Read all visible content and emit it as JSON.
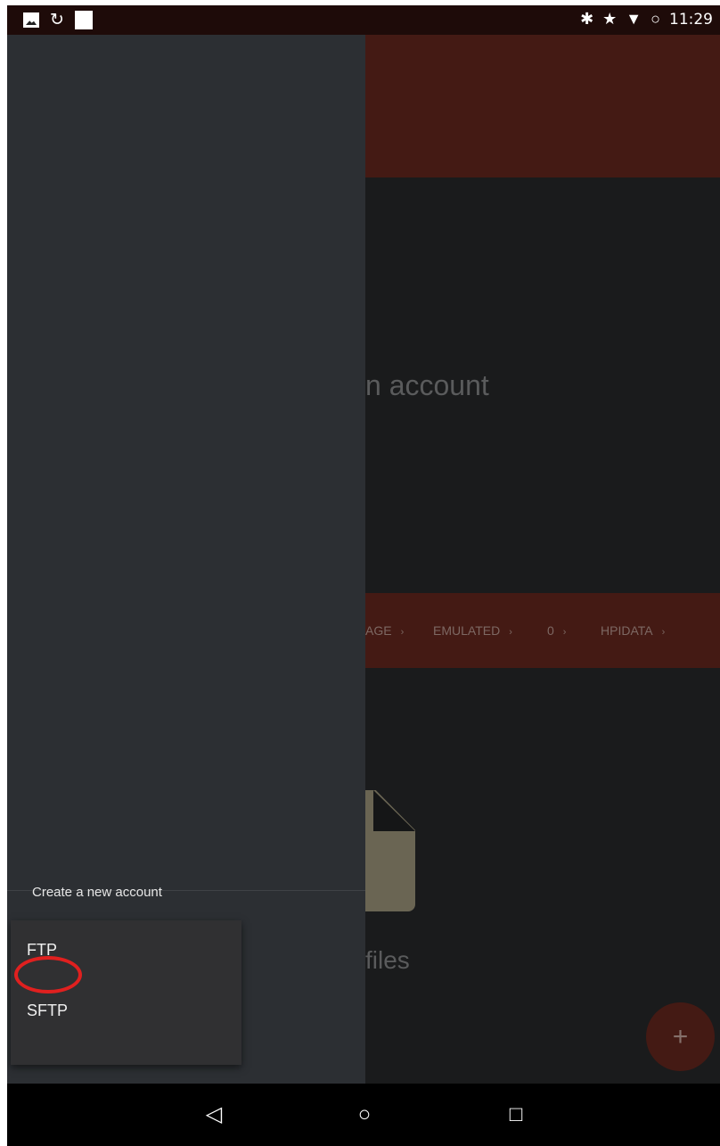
{
  "status_bar": {
    "time": "11:29",
    "left_icons": [
      "image-icon",
      "sync-icon",
      "white-square-icon"
    ],
    "right_icons": [
      "bluetooth-icon",
      "star-icon",
      "wifi-icon",
      "circle-loading-icon"
    ],
    "glyphs": {
      "bluetooth": "✱",
      "star": "★",
      "wifi": "▼",
      "circle": "○",
      "sync": "↻"
    }
  },
  "background_app": {
    "empty_accounts_text_partial": "n account",
    "empty_files_text_partial": "files",
    "breadcrumbs": [
      {
        "label": "AGE",
        "chevron": "›"
      },
      {
        "label": "EMULATED",
        "chevron": "›"
      },
      {
        "label": "0",
        "chevron": "›"
      },
      {
        "label": "HPIDATA",
        "chevron": "›"
      }
    ],
    "fab_label": "+"
  },
  "drawer": {
    "heading": "Create a new account",
    "menu": [
      {
        "label": "FTP",
        "highlighted": true
      },
      {
        "label": "SFTP",
        "highlighted": false
      }
    ]
  },
  "nav_bar": {
    "back_glyph": "◁",
    "home_glyph": "○",
    "recents_glyph": "□"
  },
  "colors": {
    "accent_dark_red": "#441a14",
    "drawer_bg": "#2c2f33",
    "highlight_ring": "#e0201f",
    "file_icon": "#6a6553"
  }
}
